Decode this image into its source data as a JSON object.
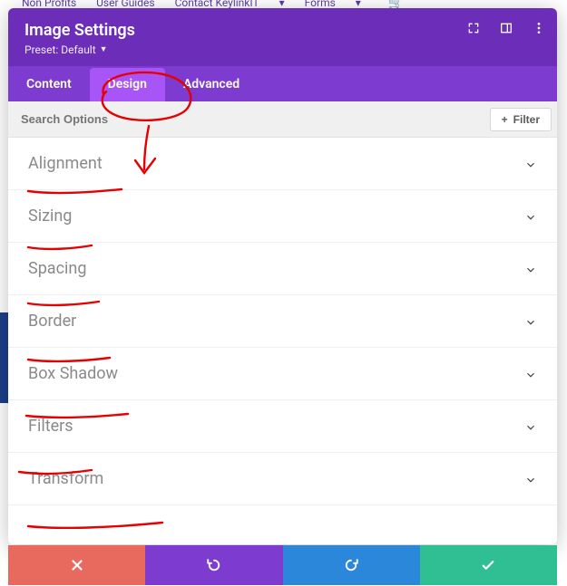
{
  "bg_nav": {
    "items": [
      "Non Profits",
      "User Guides",
      "Contact KeylinkIT",
      "Forms"
    ]
  },
  "modal": {
    "title": "Image Settings",
    "preset_label": "Preset: Default",
    "tabs": {
      "content": "Content",
      "design": "Design",
      "advanced": "Advanced",
      "active": "design"
    },
    "search_placeholder": "Search Options",
    "filter_label": "Filter",
    "options": [
      "Alignment",
      "Sizing",
      "Spacing",
      "Border",
      "Box Shadow",
      "Filters",
      "Transform"
    ],
    "footer": {
      "cancel": "cancel",
      "undo": "undo",
      "redo": "redo",
      "save": "save"
    }
  }
}
